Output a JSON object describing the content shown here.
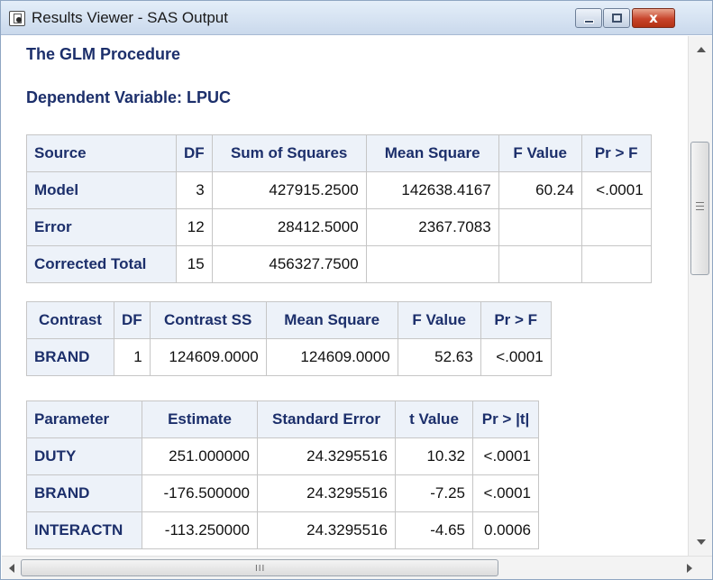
{
  "window": {
    "title": "Results Viewer - SAS Output",
    "close_glyph": "x"
  },
  "output": {
    "procedure_title": "The GLM Procedure",
    "dependent_variable": "Dependent Variable: LPUC"
  },
  "anova_table": {
    "headers": [
      "Source",
      "DF",
      "Sum of Squares",
      "Mean Square",
      "F Value",
      "Pr > F"
    ],
    "rows": [
      [
        "Model",
        "3",
        "427915.2500",
        "142638.4167",
        "60.24",
        "<.0001"
      ],
      [
        "Error",
        "12",
        "28412.5000",
        "2367.7083",
        "",
        ""
      ],
      [
        "Corrected Total",
        "15",
        "456327.7500",
        "",
        "",
        ""
      ]
    ]
  },
  "contrast_table": {
    "headers": [
      "Contrast",
      "DF",
      "Contrast SS",
      "Mean Square",
      "F Value",
      "Pr > F"
    ],
    "rows": [
      [
        "BRAND",
        "1",
        "124609.0000",
        "124609.0000",
        "52.63",
        "<.0001"
      ]
    ]
  },
  "parameter_table": {
    "headers": [
      "Parameter",
      "Estimate",
      "Standard Error",
      "t Value",
      "Pr > |t|"
    ],
    "rows": [
      [
        "DUTY",
        "251.000000",
        "24.3295516",
        "10.32",
        "<.0001"
      ],
      [
        "BRAND",
        "-176.500000",
        "24.3295516",
        "-7.25",
        "<.0001"
      ],
      [
        "INTERACTN",
        "-113.250000",
        "24.3295516",
        "-4.65",
        "0.0006"
      ]
    ]
  },
  "scrollbar": {
    "horizontal_grip": "III"
  }
}
